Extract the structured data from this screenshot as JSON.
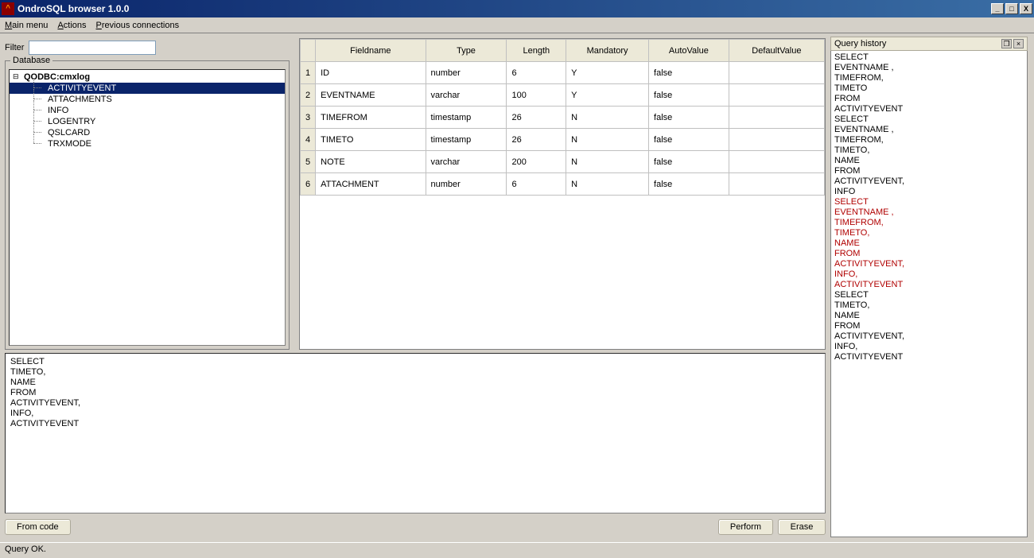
{
  "window": {
    "title": "OndroSQL browser 1.0.0",
    "min": "_",
    "max": "□",
    "close": "X"
  },
  "menu": {
    "main": "Main menu",
    "actions": "Actions",
    "prev": "Previous connections"
  },
  "filter": {
    "label": "Filter",
    "value": ""
  },
  "dbgroup_label": "Database",
  "tree": {
    "root": "QODBC:cmxlog",
    "items": [
      "ACTIVITYEVENT",
      "ATTACHMENTS",
      "INFO",
      "LOGENTRY",
      "QSLCARD",
      "TRXMODE"
    ],
    "selected": 0
  },
  "grid": {
    "cols": [
      "Fieldname",
      "Type",
      "Length",
      "Mandatory",
      "AutoValue",
      "DefaultValue"
    ],
    "rows": [
      {
        "n": "1",
        "c": [
          "ID",
          "number",
          "6",
          "Y",
          "false",
          ""
        ]
      },
      {
        "n": "2",
        "c": [
          "EVENTNAME",
          "varchar",
          "100",
          "Y",
          "false",
          ""
        ]
      },
      {
        "n": "3",
        "c": [
          "TIMEFROM",
          "timestamp",
          "26",
          "N",
          "false",
          ""
        ]
      },
      {
        "n": "4",
        "c": [
          "TIMETO",
          "timestamp",
          "26",
          "N",
          "false",
          ""
        ]
      },
      {
        "n": "5",
        "c": [
          "NOTE",
          "varchar",
          "200",
          "N",
          "false",
          ""
        ]
      },
      {
        "n": "6",
        "c": [
          "ATTACHMENT",
          "number",
          "6",
          "N",
          "false",
          ""
        ]
      }
    ]
  },
  "sql": "SELECT\nTIMETO,\nNAME\n FROM\nACTIVITYEVENT,\nINFO,\nACTIVITYEVENT",
  "buttons": {
    "fromcode": "From code",
    "perform": "Perform",
    "erase": "Erase"
  },
  "queryhistory": {
    "title": "Query history",
    "entries": [
      {
        "err": false,
        "text": "SELECT\nEVENTNAME ,\nTIMEFROM,\nTIMETO\n FROM\nACTIVITYEVENT"
      },
      {
        "err": false,
        "text": "SELECT\nEVENTNAME ,\nTIMEFROM,\nTIMETO,\nNAME\n FROM\nACTIVITYEVENT,\nINFO"
      },
      {
        "err": true,
        "text": "SELECT\nEVENTNAME ,\nTIMEFROM,\nTIMETO,\nNAME\n FROM\nACTIVITYEVENT,\nINFO,\nACTIVITYEVENT"
      },
      {
        "err": false,
        "text": "SELECT\nTIMETO,\nNAME\n FROM\nACTIVITYEVENT,\nINFO,\nACTIVITYEVENT"
      }
    ]
  },
  "status": "Query OK."
}
